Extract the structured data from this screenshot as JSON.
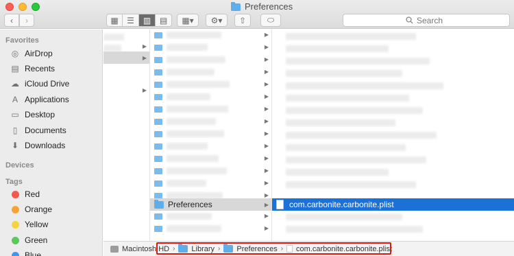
{
  "window": {
    "title": "Preferences"
  },
  "toolbar": {
    "back_glyph": "‹",
    "forward_glyph": "›",
    "view_modes": [
      {
        "icon": "icon-view-icon",
        "glyph": "▦"
      },
      {
        "icon": "list-view-icon",
        "glyph": "☰"
      },
      {
        "icon": "column-view-icon",
        "glyph": "▥"
      },
      {
        "icon": "gallery-view-icon",
        "glyph": "▤"
      }
    ],
    "arrange_glyph": "▦▾",
    "action_glyph": "⚙▾",
    "share_glyph": "⇧",
    "tag_glyph": "⬭",
    "search_placeholder": "Search"
  },
  "sidebar": {
    "favorites_header": "Favorites",
    "favorites": [
      {
        "label": "AirDrop",
        "icon": "airdrop-icon",
        "glyph": "◎"
      },
      {
        "label": "Recents",
        "icon": "recents-icon",
        "glyph": "▤"
      },
      {
        "label": "iCloud Drive",
        "icon": "cloud-icon",
        "glyph": "☁"
      },
      {
        "label": "Applications",
        "icon": "applications-icon",
        "glyph": "A"
      },
      {
        "label": "Desktop",
        "icon": "desktop-icon",
        "glyph": "▭"
      },
      {
        "label": "Documents",
        "icon": "documents-icon",
        "glyph": "▯"
      },
      {
        "label": "Downloads",
        "icon": "downloads-icon",
        "glyph": "⬇"
      }
    ],
    "devices_header": "Devices",
    "tags_header": "Tags",
    "tags": [
      {
        "label": "Red",
        "color": "#f5574b"
      },
      {
        "label": "Orange",
        "color": "#f9a336"
      },
      {
        "label": "Yellow",
        "color": "#f7d33f"
      },
      {
        "label": "Green",
        "color": "#5ac85a"
      },
      {
        "label": "Blue",
        "color": "#3d97f5"
      }
    ]
  },
  "columns": {
    "preferences_folder": "Preferences",
    "selected_file": "com.carbonite.carbonite.plist"
  },
  "pathbar": {
    "segments": [
      "Macintosh HD",
      "Library",
      "Preferences",
      "com.carbonite.carbonite.plist"
    ]
  }
}
